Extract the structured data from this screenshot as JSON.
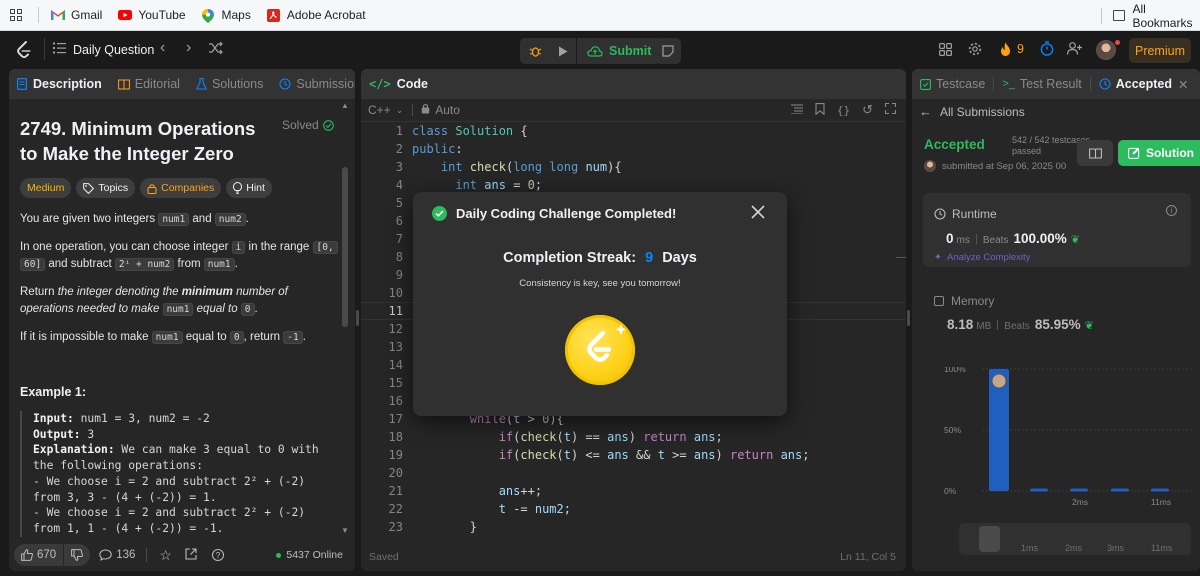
{
  "bookmarks": {
    "items": [
      {
        "label": "Gmail",
        "icon": "gmail-icon"
      },
      {
        "label": "YouTube",
        "icon": "youtube-icon"
      },
      {
        "label": "Maps",
        "icon": "maps-icon"
      },
      {
        "label": "Adobe Acrobat",
        "icon": "acrobat-icon"
      }
    ],
    "all_bookmarks": "All Bookmarks"
  },
  "topnav": {
    "daily_question": "Daily Question",
    "submit": "Submit",
    "streak_count": "9",
    "premium": "Premium"
  },
  "left": {
    "tabs": [
      "Description",
      "Editorial",
      "Solutions",
      "Submissions"
    ],
    "title": "2749. Minimum Operations to Make the Integer Zero",
    "title_line1": "2749. Minimum Operations",
    "title_line2": "to Make the Integer Zero",
    "status": "Solved",
    "tags": [
      "Medium",
      "Topics",
      "Companies",
      "Hint"
    ],
    "p1_a": "You are given two integers ",
    "p1_c1": "num1",
    "p1_b": " and ",
    "p1_c2": "num2",
    "p1_d": ".",
    "p2_a": "In one operation, you can choose integer ",
    "p2_c1": "i",
    "p2_b": " in the range ",
    "p2_c2": "[0,",
    "p2_c3": "60]",
    "p2_c": " and subtract ",
    "p2_c4": "2ⁱ + num2",
    "p2_d": " from ",
    "p2_c5": "num1",
    "p2_e": ".",
    "p3_a": "Return ",
    "p3_b": "the integer denoting the ",
    "p3_strong": "minimum",
    "p3_c": " number of operations needed to make ",
    "p3_c1": "num1",
    "p3_d": " equal to ",
    "p3_c2": "0",
    "p3_e": ".",
    "p4_a": "If it is impossible to make ",
    "p4_c1": "num1",
    "p4_b": " equal to ",
    "p4_c2": "0",
    "p4_c": ", return ",
    "p4_c3": "-1",
    "p4_d": ".",
    "example_title": "Example 1:",
    "example_lines": [
      {
        "bold": "Input:",
        "text": " num1 = 3, num2 = -2"
      },
      {
        "bold": "Output:",
        "text": " 3"
      },
      {
        "bold": "Explanation:",
        "text": " We can make 3 equal to 0 with"
      },
      {
        "bold": "",
        "text": "the following operations:"
      },
      {
        "bold": "",
        "text": "- We choose i = 2 and subtract 2² + (-2)"
      },
      {
        "bold": "",
        "text": "from 3, 3 - (4 + (-2)) = 1."
      },
      {
        "bold": "",
        "text": "- We choose i = 2 and subtract 2² + (-2)"
      },
      {
        "bold": "",
        "text": "from 1, 1 - (4 + (-2)) = -1."
      }
    ],
    "footer": {
      "likes": "670",
      "comments": "136",
      "online": "5437 Online"
    }
  },
  "mid": {
    "tab": "Code",
    "language": "C++",
    "mode": "Auto",
    "status": "Saved",
    "cursor": "Ln 11, Col 5",
    "lines": [
      {
        "n": "1",
        "html": "<span class='kw'>class</span> <span class='cls'>Solution</span> {"
      },
      {
        "n": "2",
        "html": "<span class='kw'>public</span>:"
      },
      {
        "n": "3",
        "html": "    <span class='kw'>int</span> <span class='fn'>check</span>(<span class='kw'>long long</span> <span class='var'>num</span>){"
      },
      {
        "n": "4",
        "html": "      <span class='kw'>int</span> <span class='var'>ans</span> = <span class='num'>0</span>;"
      },
      {
        "n": "5",
        "html": ""
      },
      {
        "n": "6",
        "html": ""
      },
      {
        "n": "7",
        "html": ""
      },
      {
        "n": "8",
        "html": ""
      },
      {
        "n": "9",
        "html": ""
      },
      {
        "n": "10",
        "html": ""
      },
      {
        "n": "11",
        "html": ""
      },
      {
        "n": "12",
        "html": ""
      },
      {
        "n": "13",
        "html": ""
      },
      {
        "n": "14",
        "html": ""
      },
      {
        "n": "15",
        "html": ""
      },
      {
        "n": "16",
        "html": ""
      },
      {
        "n": "17",
        "html": "        <span class='kw2'>while</span>(<span class='var'>t</span> > <span class='num'>0</span>){"
      },
      {
        "n": "18",
        "html": "            <span class='kw2'>if</span>(<span class='fn'>check</span>(<span class='var'>t</span>) == <span class='var'>ans</span>) <span class='kw2'>return</span> <span class='var'>ans</span>;"
      },
      {
        "n": "19",
        "html": "            <span class='kw2'>if</span>(<span class='fn'>check</span>(<span class='var'>t</span>) <= <span class='var'>ans</span> && <span class='var'>t</span> >= <span class='var'>ans</span>) <span class='kw2'>return</span> <span class='var'>ans</span>;"
      },
      {
        "n": "20",
        "html": ""
      },
      {
        "n": "21",
        "html": "            <span class='var'>ans</span>++;"
      },
      {
        "n": "22",
        "html": "            <span class='var'>t</span> -= <span class='var'>num2</span>;"
      },
      {
        "n": "23",
        "html": "        }"
      }
    ]
  },
  "right": {
    "tabs": [
      "Testcase",
      "Test Result",
      "Accepted"
    ],
    "all_submissions": "All Submissions",
    "accepted": "Accepted",
    "testcases": "542 / 542 testcases",
    "passed": "passed",
    "submitted": "submitted at Sep 06, 2025 00",
    "solution_btn": "Solution",
    "runtime_label": "Runtime",
    "runtime_value": "0",
    "runtime_unit": "ms",
    "beats_label": "Beats",
    "runtime_beats": "100.00%",
    "analyze": "Analyze Complexity",
    "memory_label": "Memory",
    "memory_value": "8.18",
    "memory_unit": "MB",
    "memory_beats": "85.95%",
    "chart_y_labels": [
      "100%",
      "50%",
      "0%"
    ],
    "chart_x_labels": [
      "2ms",
      "11ms"
    ],
    "mini_x_labels": [
      "1ms",
      "2ms",
      "3ms",
      "11ms"
    ]
  },
  "chart_data": {
    "type": "bar",
    "categories": [
      "0ms",
      "",
      "2ms",
      "",
      "11ms"
    ],
    "values": [
      100,
      2,
      2,
      2,
      2
    ],
    "ylim": [
      0,
      100
    ],
    "y_ticks": [
      "100%",
      "50%",
      "0%"
    ]
  },
  "modal": {
    "title": "Daily Coding Challenge Completed!",
    "streak_label": "Completion Streak:",
    "streak_value": "9",
    "streak_unit": "Days",
    "subtitle": "Consistency is key, see you tomorrow!"
  },
  "colors": {
    "accent_green": "#2cbb5d",
    "orange": "#ffa116",
    "blue": "#0a84ff",
    "bar_blue": "#1f5fbf"
  }
}
